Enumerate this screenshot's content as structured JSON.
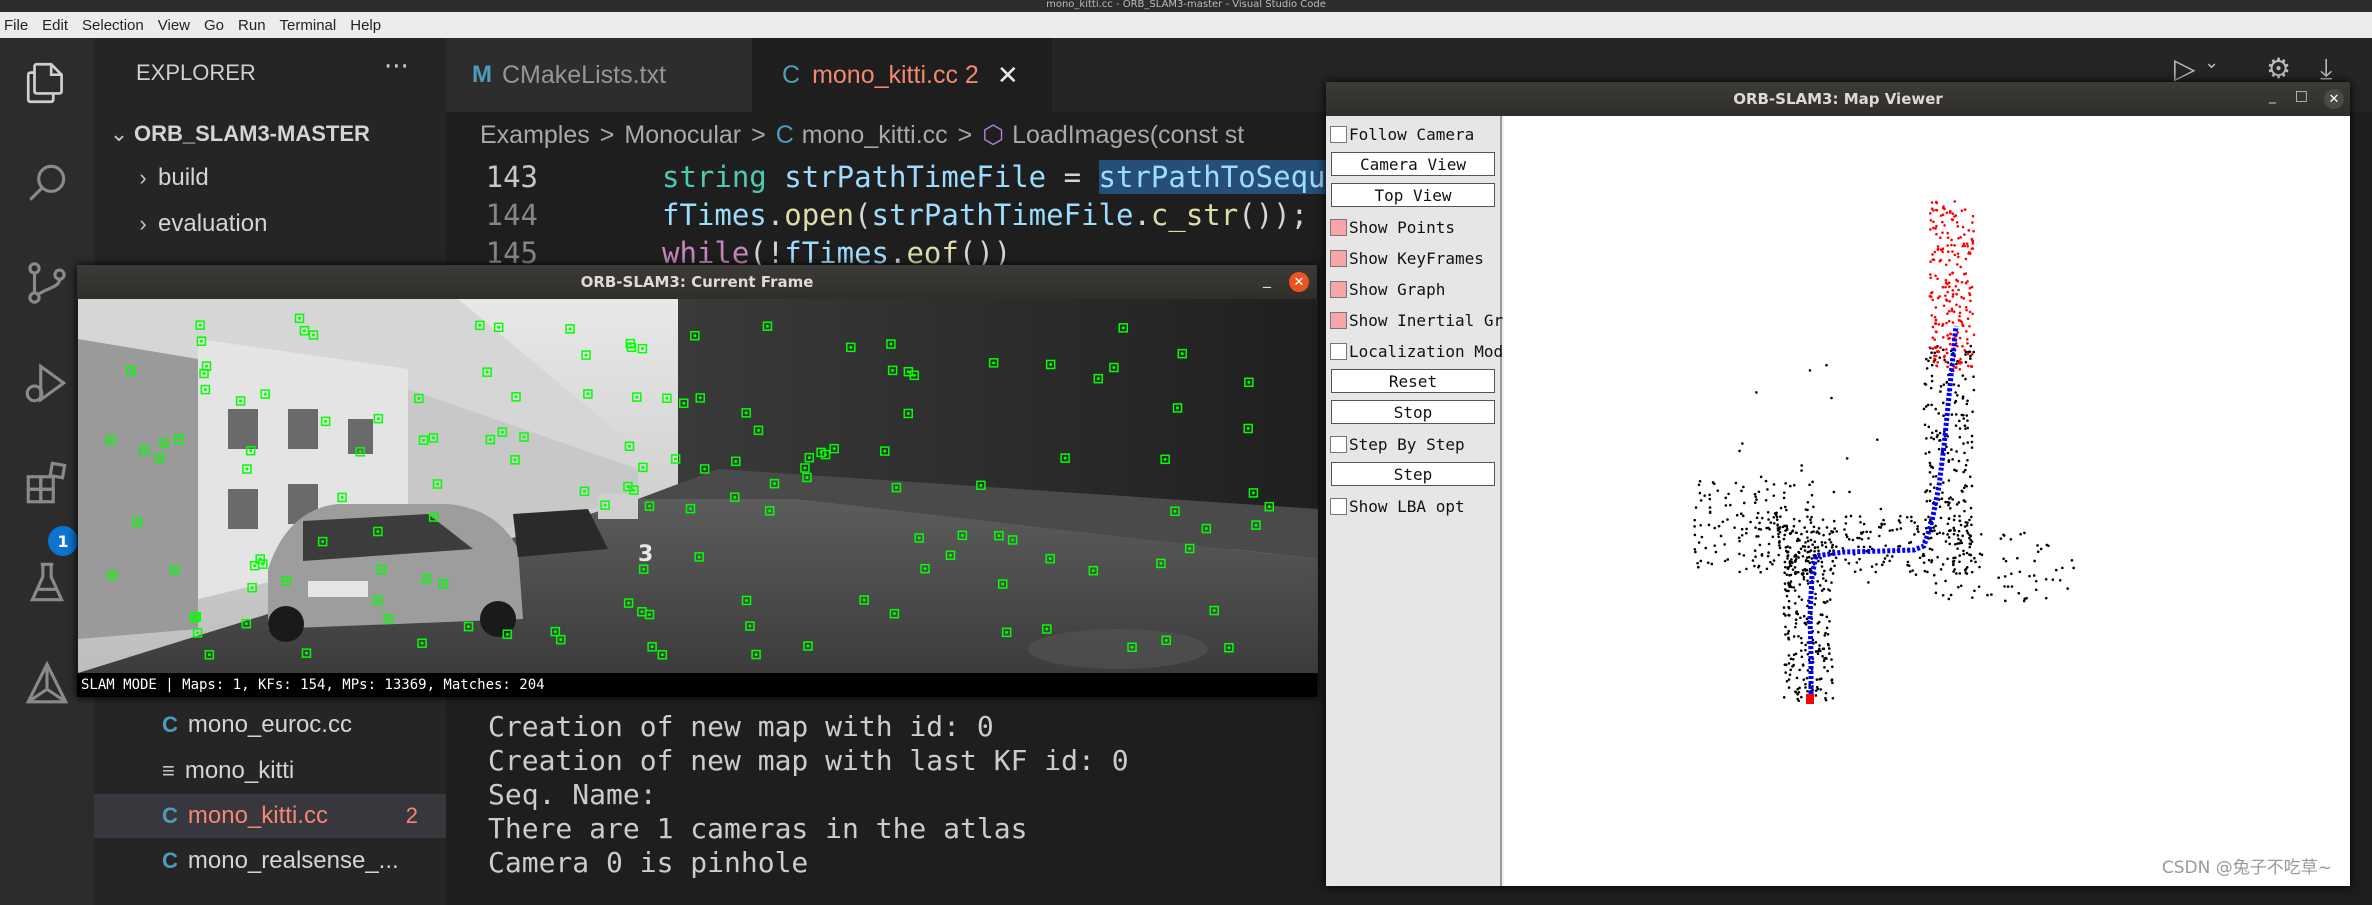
{
  "os_title": "mono_kitti.cc - ORB_SLAM3-master - Visual Studio Code",
  "menu": [
    "File",
    "Edit",
    "Selection",
    "View",
    "Go",
    "Run",
    "Terminal",
    "Help"
  ],
  "activity": {
    "icons": [
      "explorer-icon",
      "search-icon",
      "source-control-icon",
      "run-debug-icon",
      "extensions-icon",
      "testing-icon",
      "cmake-icon"
    ],
    "extensions_badge": "1"
  },
  "sidebar": {
    "header": "EXPLORER",
    "more": "···",
    "root": "ORB_SLAM3-MASTER",
    "folders": [
      "build",
      "evaluation"
    ],
    "files": [
      {
        "icon": "C",
        "name": "mono_euroc.cc",
        "badge": ""
      },
      {
        "icon": "≡",
        "name": "mono_kitti",
        "badge": ""
      },
      {
        "icon": "C",
        "name": "mono_kitti.cc",
        "badge": "2"
      },
      {
        "icon": "C",
        "name": "mono_realsense_...",
        "badge": ""
      }
    ]
  },
  "tabs": [
    {
      "icon": "M",
      "label": "CMakeLists.txt"
    },
    {
      "icon": "C",
      "label": "mono_kitti.cc 2",
      "close": "✕"
    }
  ],
  "breadcrumb": {
    "parts": [
      "Examples",
      "Monocular",
      "mono_kitti.cc",
      "LoadImages(const st"
    ],
    "sep": ">"
  },
  "code": {
    "lines": [
      {
        "num": "143",
        "kw": "string",
        "v1": "strPathTimeFile",
        "op": " = ",
        "v2": "strPathToSequ"
      },
      {
        "num": "144",
        "v1": "fTimes",
        "dot": ".",
        "fn": "open",
        "p1": "(",
        "v2": "strPathTimeFile",
        "dot2": ".",
        "fn2": "c_str",
        "p2": "());"
      },
      {
        "num": "145",
        "ctl": "while",
        "p1": "(!",
        "v2": "fTimes",
        "dot": ".",
        "fn": "eof",
        "p2": "())"
      }
    ]
  },
  "terminal": [
    "Creation of new map with id: 0",
    "Creation of new map with last KF id: 0",
    "Seq. Name:",
    "There are 1 cameras in the atlas",
    "Camera 0 is pinhole"
  ],
  "current_frame": {
    "title": "ORB-SLAM3: Current Frame",
    "minimize": "_",
    "close": "✕",
    "status": "SLAM MODE |  Maps: 1, KFs: 154, MPs: 13369, Matches: 204",
    "road_marking": "3",
    "feature_color": "#00ff00"
  },
  "map_viewer": {
    "title": "ORB-SLAM3: Map Viewer",
    "controls": [
      "_",
      "□",
      "✕"
    ],
    "panel": [
      {
        "type": "check",
        "label": "Follow Camera",
        "checked": false
      },
      {
        "type": "button",
        "label": "Camera View"
      },
      {
        "type": "button",
        "label": "Top View"
      },
      {
        "type": "check",
        "label": "Show Points",
        "checked": true
      },
      {
        "type": "check",
        "label": "Show KeyFrames",
        "checked": true
      },
      {
        "type": "check",
        "label": "Show Graph",
        "checked": true
      },
      {
        "type": "check",
        "label": "Show Inertial Graph",
        "checked": true
      },
      {
        "type": "check",
        "label": "Localization Mode",
        "checked": false
      },
      {
        "type": "button",
        "label": "Reset"
      },
      {
        "type": "button",
        "label": "Stop"
      },
      {
        "type": "check",
        "label": "Step By Step",
        "checked": false
      },
      {
        "type": "button",
        "label": "Step"
      },
      {
        "type": "check",
        "label": "Show LBA opt",
        "checked": false
      }
    ],
    "colors": {
      "points": "#000000",
      "local_points": "#ff0000",
      "trajectory": "#0000ff"
    }
  },
  "watermark": "CSDN @兔子不吃草~"
}
